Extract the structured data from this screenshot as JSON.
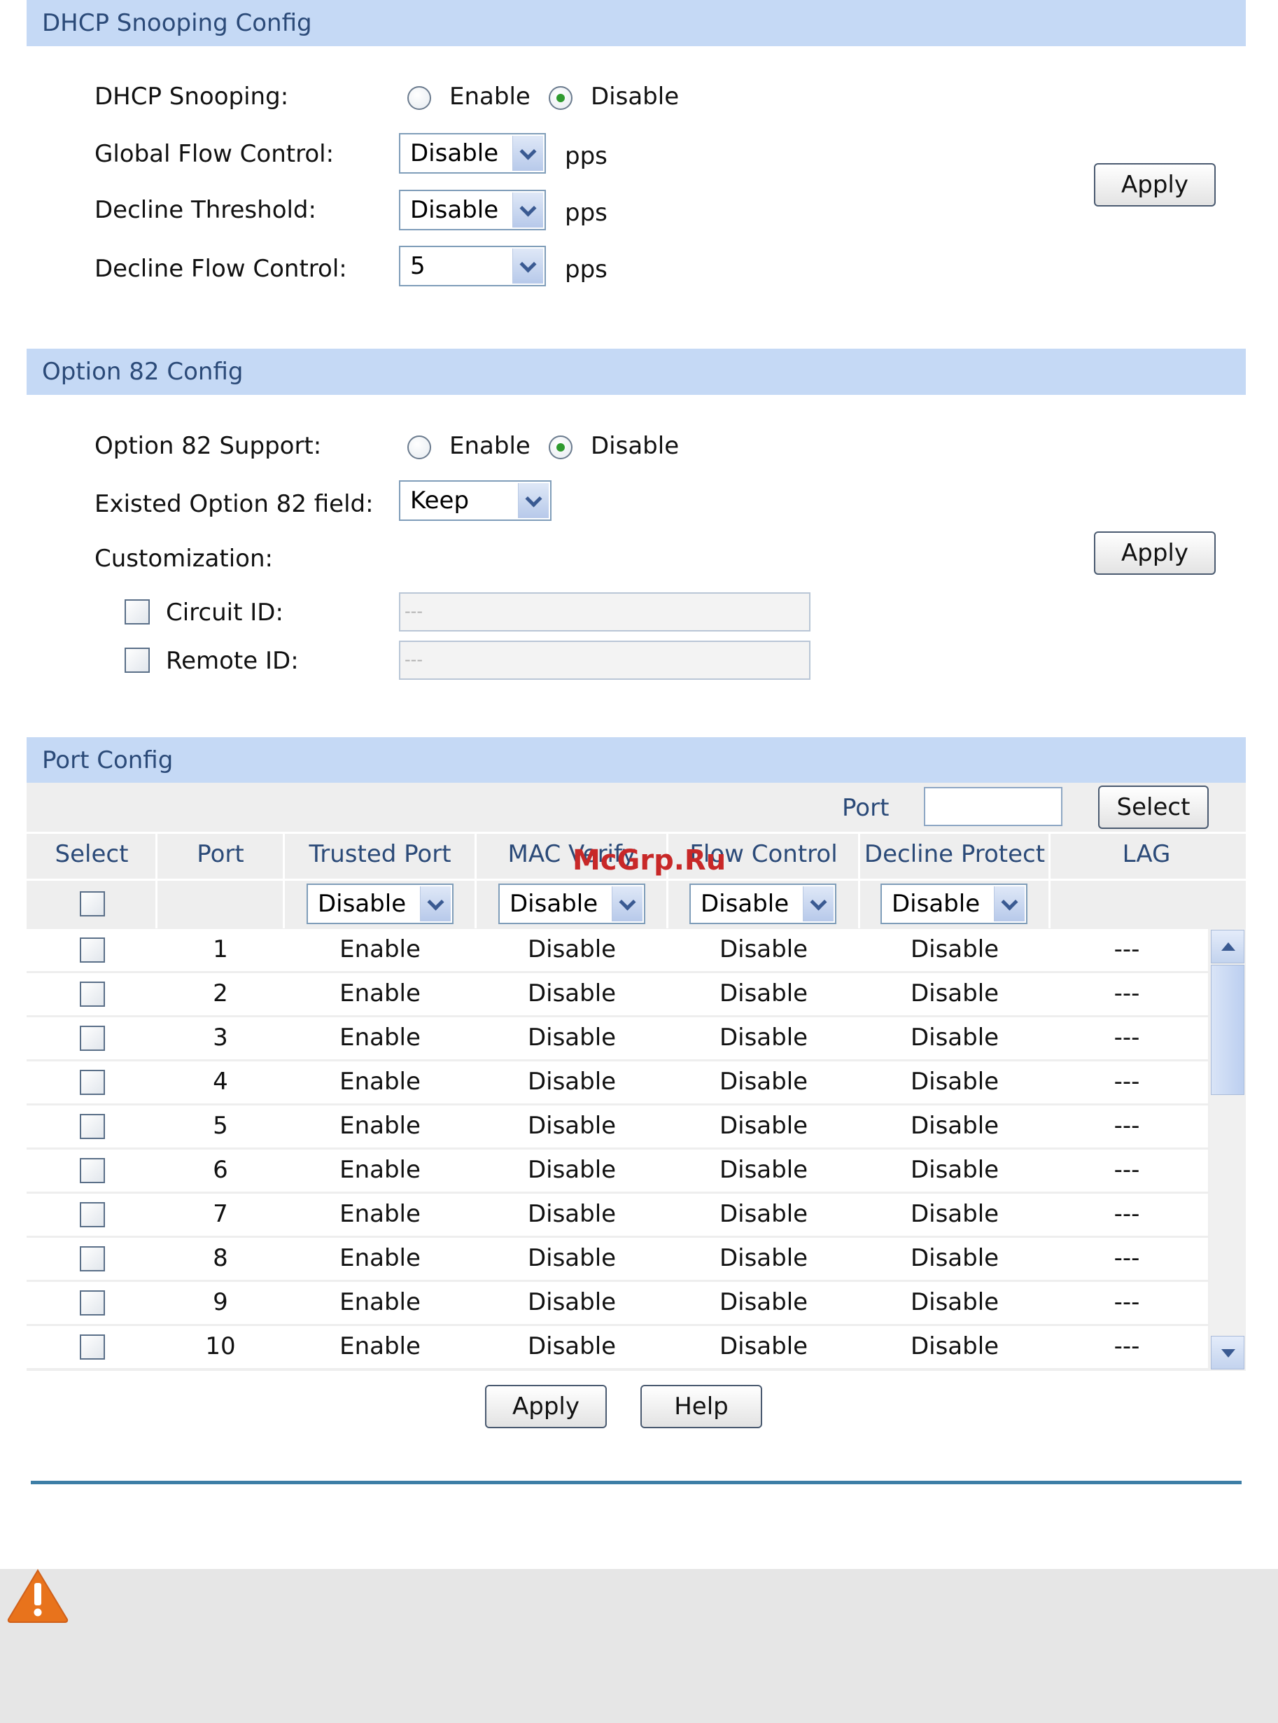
{
  "dhcp_section": {
    "title": "DHCP Snooping Config",
    "snooping_label": "DHCP Snooping:",
    "enable_label": "Enable",
    "disable_label": "Disable",
    "selected": "Disable",
    "global_flow_label": "Global Flow Control:",
    "global_flow_value": "Disable",
    "decline_threshold_label": "Decline Threshold:",
    "decline_threshold_value": "Disable",
    "decline_flow_label": "Decline Flow Control:",
    "decline_flow_value": "5",
    "unit": "pps",
    "apply_label": "Apply"
  },
  "option82_section": {
    "title": "Option 82 Config",
    "support_label": "Option 82 Support:",
    "enable_label": "Enable",
    "disable_label": "Disable",
    "selected": "Disable",
    "existed_field_label": "Existed Option 82 field:",
    "existed_field_value": "Keep",
    "customization_label": "Customization:",
    "circuit_id_label": "Circuit ID:",
    "circuit_id_value": "---",
    "remote_id_label": "Remote ID:",
    "remote_id_value": "---",
    "apply_label": "Apply"
  },
  "port_section": {
    "title": "Port Config",
    "port_filter_label": "Port",
    "port_filter_value": "",
    "select_button_label": "Select",
    "columns": [
      "Select",
      "Port",
      "Trusted Port",
      "MAC Verify",
      "Flow Control",
      "Decline Protect",
      "LAG"
    ],
    "bulk": {
      "trusted_port": "Disable",
      "mac_verify": "Disable",
      "flow_control": "Disable",
      "decline_protect": "Disable"
    },
    "rows": [
      {
        "port": "1",
        "trusted": "Enable",
        "mac": "Disable",
        "flow": "Disable",
        "decline": "Disable",
        "lag": "---"
      },
      {
        "port": "2",
        "trusted": "Enable",
        "mac": "Disable",
        "flow": "Disable",
        "decline": "Disable",
        "lag": "---"
      },
      {
        "port": "3",
        "trusted": "Enable",
        "mac": "Disable",
        "flow": "Disable",
        "decline": "Disable",
        "lag": "---"
      },
      {
        "port": "4",
        "trusted": "Enable",
        "mac": "Disable",
        "flow": "Disable",
        "decline": "Disable",
        "lag": "---"
      },
      {
        "port": "5",
        "trusted": "Enable",
        "mac": "Disable",
        "flow": "Disable",
        "decline": "Disable",
        "lag": "---"
      },
      {
        "port": "6",
        "trusted": "Enable",
        "mac": "Disable",
        "flow": "Disable",
        "decline": "Disable",
        "lag": "---"
      },
      {
        "port": "7",
        "trusted": "Enable",
        "mac": "Disable",
        "flow": "Disable",
        "decline": "Disable",
        "lag": "---"
      },
      {
        "port": "8",
        "trusted": "Enable",
        "mac": "Disable",
        "flow": "Disable",
        "decline": "Disable",
        "lag": "---"
      },
      {
        "port": "9",
        "trusted": "Enable",
        "mac": "Disable",
        "flow": "Disable",
        "decline": "Disable",
        "lag": "---"
      },
      {
        "port": "10",
        "trusted": "Enable",
        "mac": "Disable",
        "flow": "Disable",
        "decline": "Disable",
        "lag": "---"
      }
    ],
    "apply_label": "Apply",
    "help_label": "Help"
  },
  "watermark": "McGrp.Ru",
  "colors": {
    "section_header_bg": "#c5d9f5",
    "section_header_text": "#2b4a78",
    "divider": "#3d7ea6",
    "warning_icon": "#e8731c",
    "note_bg": "#e6e6e6"
  }
}
